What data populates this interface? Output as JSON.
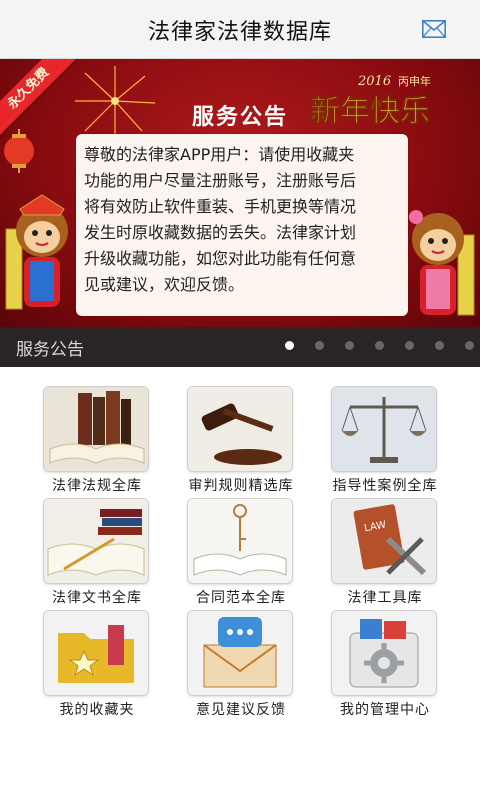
{
  "header": {
    "title": "法律家法律数据库"
  },
  "banner": {
    "ribbon_text": "永久免费",
    "newyear_year": "2016",
    "newyear_tag": "丙申年",
    "newyear_text": "新年快乐",
    "notice_title": "服务公告",
    "notice_lines": [
      "尊敬的法律家APP用户：请使用收藏夹",
      "功能的用户尽量注册账号，注册账号后",
      "将有效防止软件重装、手机更换等情况",
      "发生时原收藏数据的丢失。法律家计划",
      "升级收藏功能，如您对此功能有任何意",
      "见或建议，欢迎反馈。"
    ]
  },
  "carousel": {
    "caption": "服务公告",
    "dot_count": 7,
    "active_index": 0
  },
  "tiles": [
    {
      "label": "法律法规全库",
      "icon": "law-books-icon"
    },
    {
      "label": "审判规则精选库",
      "icon": "gavel-icon"
    },
    {
      "label": "指导性案例全库",
      "icon": "scales-icon"
    },
    {
      "label": "法律文书全库",
      "icon": "document-pen-icon"
    },
    {
      "label": "合同范本全库",
      "icon": "key-book-icon"
    },
    {
      "label": "法律工具库",
      "icon": "law-tools-icon"
    },
    {
      "label": "我的收藏夹",
      "icon": "favorites-folder-icon"
    },
    {
      "label": "意见建议反馈",
      "icon": "feedback-envelope-icon"
    },
    {
      "label": "我的管理中心",
      "icon": "management-gear-icon"
    }
  ],
  "colors": {
    "banner_red": "#8a0c10",
    "caption_bar": "#2a2424",
    "notice_card": "#fbf4ef"
  }
}
